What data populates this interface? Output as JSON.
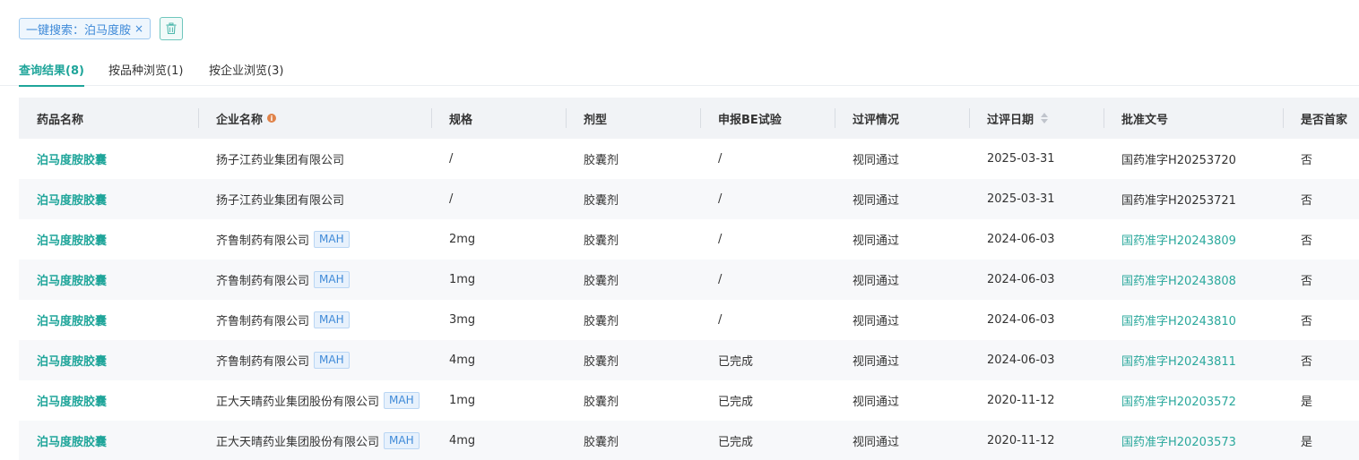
{
  "search_tag": {
    "label": "一键搜索：泊马度胺",
    "close_glyph": "×"
  },
  "tabs": [
    {
      "label": "查询结果(8)",
      "active": true
    },
    {
      "label": "按品种浏览(1)",
      "active": false
    },
    {
      "label": "按企业浏览(3)",
      "active": false
    }
  ],
  "table": {
    "headers": [
      "药品名称",
      "企业名称",
      "规格",
      "剂型",
      "申报BE试验",
      "过评情况",
      "过评日期",
      "批准文号",
      "是否首家"
    ],
    "mah_label": "MAH",
    "rows": [
      {
        "drug": "泊马度胺胶囊",
        "company": "扬子江药业集团有限公司",
        "mah": false,
        "spec": "/",
        "form": "胶囊剂",
        "be": "/",
        "status": "视同通过",
        "date": "2025-03-31",
        "approval": "国药准字H20253720",
        "approval_link": false,
        "first": "否"
      },
      {
        "drug": "泊马度胺胶囊",
        "company": "扬子江药业集团有限公司",
        "mah": false,
        "spec": "/",
        "form": "胶囊剂",
        "be": "/",
        "status": "视同通过",
        "date": "2025-03-31",
        "approval": "国药准字H20253721",
        "approval_link": false,
        "first": "否"
      },
      {
        "drug": "泊马度胺胶囊",
        "company": "齐鲁制药有限公司",
        "mah": true,
        "spec": "2mg",
        "form": "胶囊剂",
        "be": "/",
        "status": "视同通过",
        "date": "2024-06-03",
        "approval": "国药准字H20243809",
        "approval_link": true,
        "first": "否"
      },
      {
        "drug": "泊马度胺胶囊",
        "company": "齐鲁制药有限公司",
        "mah": true,
        "spec": "1mg",
        "form": "胶囊剂",
        "be": "/",
        "status": "视同通过",
        "date": "2024-06-03",
        "approval": "国药准字H20243808",
        "approval_link": true,
        "first": "否"
      },
      {
        "drug": "泊马度胺胶囊",
        "company": "齐鲁制药有限公司",
        "mah": true,
        "spec": "3mg",
        "form": "胶囊剂",
        "be": "/",
        "status": "视同通过",
        "date": "2024-06-03",
        "approval": "国药准字H20243810",
        "approval_link": true,
        "first": "否"
      },
      {
        "drug": "泊马度胺胶囊",
        "company": "齐鲁制药有限公司",
        "mah": true,
        "spec": "4mg",
        "form": "胶囊剂",
        "be": "已完成",
        "status": "视同通过",
        "date": "2024-06-03",
        "approval": "国药准字H20243811",
        "approval_link": true,
        "first": "否"
      },
      {
        "drug": "泊马度胺胶囊",
        "company": "正大天晴药业集团股份有限公司",
        "mah": true,
        "spec": "1mg",
        "form": "胶囊剂",
        "be": "已完成",
        "status": "视同通过",
        "date": "2020-11-12",
        "approval": "国药准字H20203572",
        "approval_link": true,
        "first": "是"
      },
      {
        "drug": "泊马度胺胶囊",
        "company": "正大天晴药业集团股份有限公司",
        "mah": true,
        "spec": "4mg",
        "form": "胶囊剂",
        "be": "已完成",
        "status": "视同通过",
        "date": "2020-11-12",
        "approval": "国药准字H20203573",
        "approval_link": true,
        "first": "是"
      }
    ]
  },
  "colors": {
    "accent": "#1fa59a",
    "link": "#2aa89c",
    "tag_blue": "#3f8ad8",
    "header_bg": "#f1f3f6",
    "alt_row_bg": "#f7f8fa",
    "info_icon": "#e0834a"
  },
  "icons": {
    "trash": "trash-icon",
    "info": "info-icon",
    "sort": "sort-icon"
  }
}
